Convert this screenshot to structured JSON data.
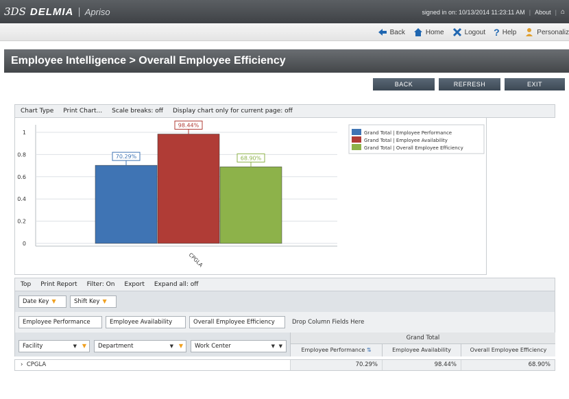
{
  "app": {
    "logo_mark": "3DS",
    "brand_name": "DELMIA",
    "brand_separator": "|",
    "app_name": "Apriso",
    "signed_in": "signed in on: 10/13/2014 11:23:11 AM",
    "about_label": "About"
  },
  "nav": {
    "back": "Back",
    "home": "Home",
    "logout": "Logout",
    "help": "Help",
    "personalize": "Personaliz"
  },
  "page": {
    "title": "Employee Intelligence > Overall Employee Efficiency"
  },
  "actions": {
    "back": "BACK",
    "refresh": "REFRESH",
    "exit": "EXIT"
  },
  "chart_toolbar": {
    "chart_type": "Chart Type",
    "print_chart": "Print Chart...",
    "scale_breaks": "Scale breaks: off",
    "display_only": "Display chart only for current page: off"
  },
  "chart_data": {
    "type": "bar",
    "categories": [
      "CPGLA"
    ],
    "series": [
      {
        "name": "Grand Total | Employee Performance",
        "values": [
          0.7029
        ],
        "label": "70.29%",
        "color": "#3f74b4"
      },
      {
        "name": "Grand Total | Employee Availability",
        "values": [
          0.9844
        ],
        "label": "98.44%",
        "color": "#b03c36"
      },
      {
        "name": "Grand Total | Overall Employee Efficiency",
        "values": [
          0.689
        ],
        "label": "68.90%",
        "color": "#8db24a"
      }
    ],
    "yticks": [
      "0",
      "0.2",
      "0.4",
      "0.6",
      "0.8",
      "1"
    ],
    "ylim": [
      0,
      1.1
    ],
    "grid": true,
    "legend_position": "top-right"
  },
  "report_toolbar": {
    "top": "Top",
    "print_report": "Print Report",
    "filter": "Filter: On",
    "export": "Export",
    "expand_all": "Expand all: off"
  },
  "filters": {
    "date_key": "Date Key",
    "shift_key": "Shift Key"
  },
  "data_fields": {
    "employee_performance": "Employee Performance",
    "employee_availability": "Employee Availability",
    "overall_efficiency": "Overall Employee Efficiency",
    "drop_hint": "Drop Column Fields Here"
  },
  "row_fields": {
    "facility": "Facility",
    "department": "Department",
    "work_center": "Work Center"
  },
  "grid": {
    "grand_total": "Grand Total",
    "columns": [
      "Employee Performance",
      "Employee Availability",
      "Overall Employee Efficiency"
    ],
    "rows": [
      {
        "label": "CPGLA",
        "values": [
          "70.29%",
          "98.44%",
          "68.90%"
        ]
      }
    ]
  }
}
